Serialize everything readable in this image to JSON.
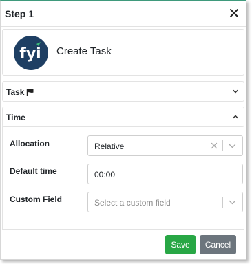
{
  "dialog": {
    "title": "Step 1",
    "close_icon": "close-icon"
  },
  "summary": {
    "logo_text": "fyi",
    "logo_color": "#1e3f63",
    "logo_accent": "#3cc07a",
    "title": "Create Task"
  },
  "sections": {
    "task": {
      "label": "Task",
      "icon": "flag-icon",
      "expanded": false
    },
    "time": {
      "label": "Time",
      "expanded": true
    }
  },
  "fields": {
    "allocation": {
      "label": "Allocation",
      "value": "Relative"
    },
    "default_time": {
      "label": "Default time",
      "value": "00:00"
    },
    "custom_field": {
      "label": "Custom Field",
      "placeholder": "Select a custom field"
    }
  },
  "buttons": {
    "save": "Save",
    "cancel": "Cancel"
  },
  "colors": {
    "save": "#28a745",
    "cancel": "#6c757d",
    "top_border": "#3f9a7c"
  }
}
